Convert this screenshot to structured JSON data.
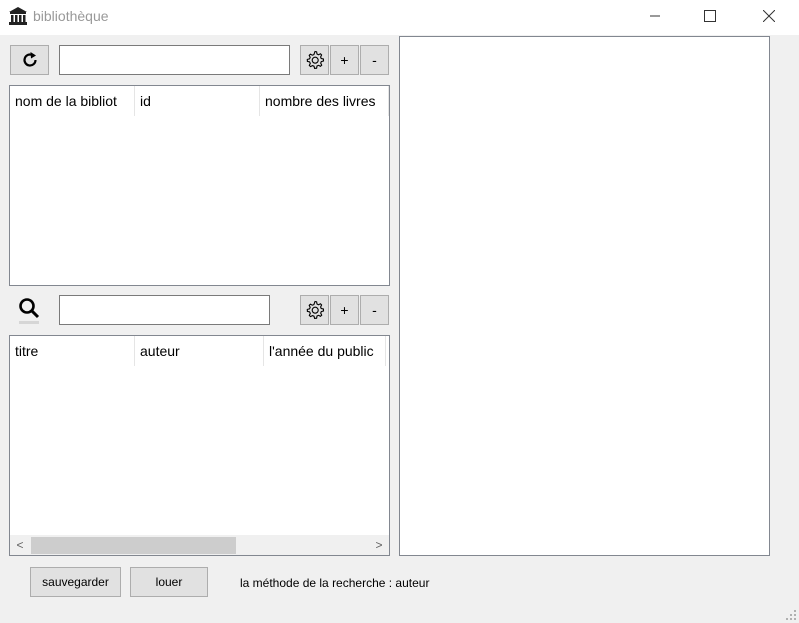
{
  "window": {
    "title": "bibliothèque",
    "minimize_glyph": "—",
    "maximize_glyph": "☐",
    "close_glyph": "✕"
  },
  "libraries": {
    "refresh_icon": "refresh-icon",
    "search_value": "",
    "settings_icon": "gear-icon",
    "add_label": "+",
    "remove_label": "-",
    "columns": [
      "nom de la bibliot",
      "id",
      "nombre des livres"
    ]
  },
  "books": {
    "search_icon": "search-icon",
    "search_value": "",
    "settings_icon": "gear-icon",
    "add_label": "+",
    "remove_label": "-",
    "columns": [
      "titre",
      "auteur",
      "l'année du public"
    ],
    "scroll_left": "<",
    "scroll_right": ">"
  },
  "footer": {
    "save_label": "sauvegarder",
    "rent_label": "louer",
    "search_method": "la méthode de la recherche : auteur"
  }
}
